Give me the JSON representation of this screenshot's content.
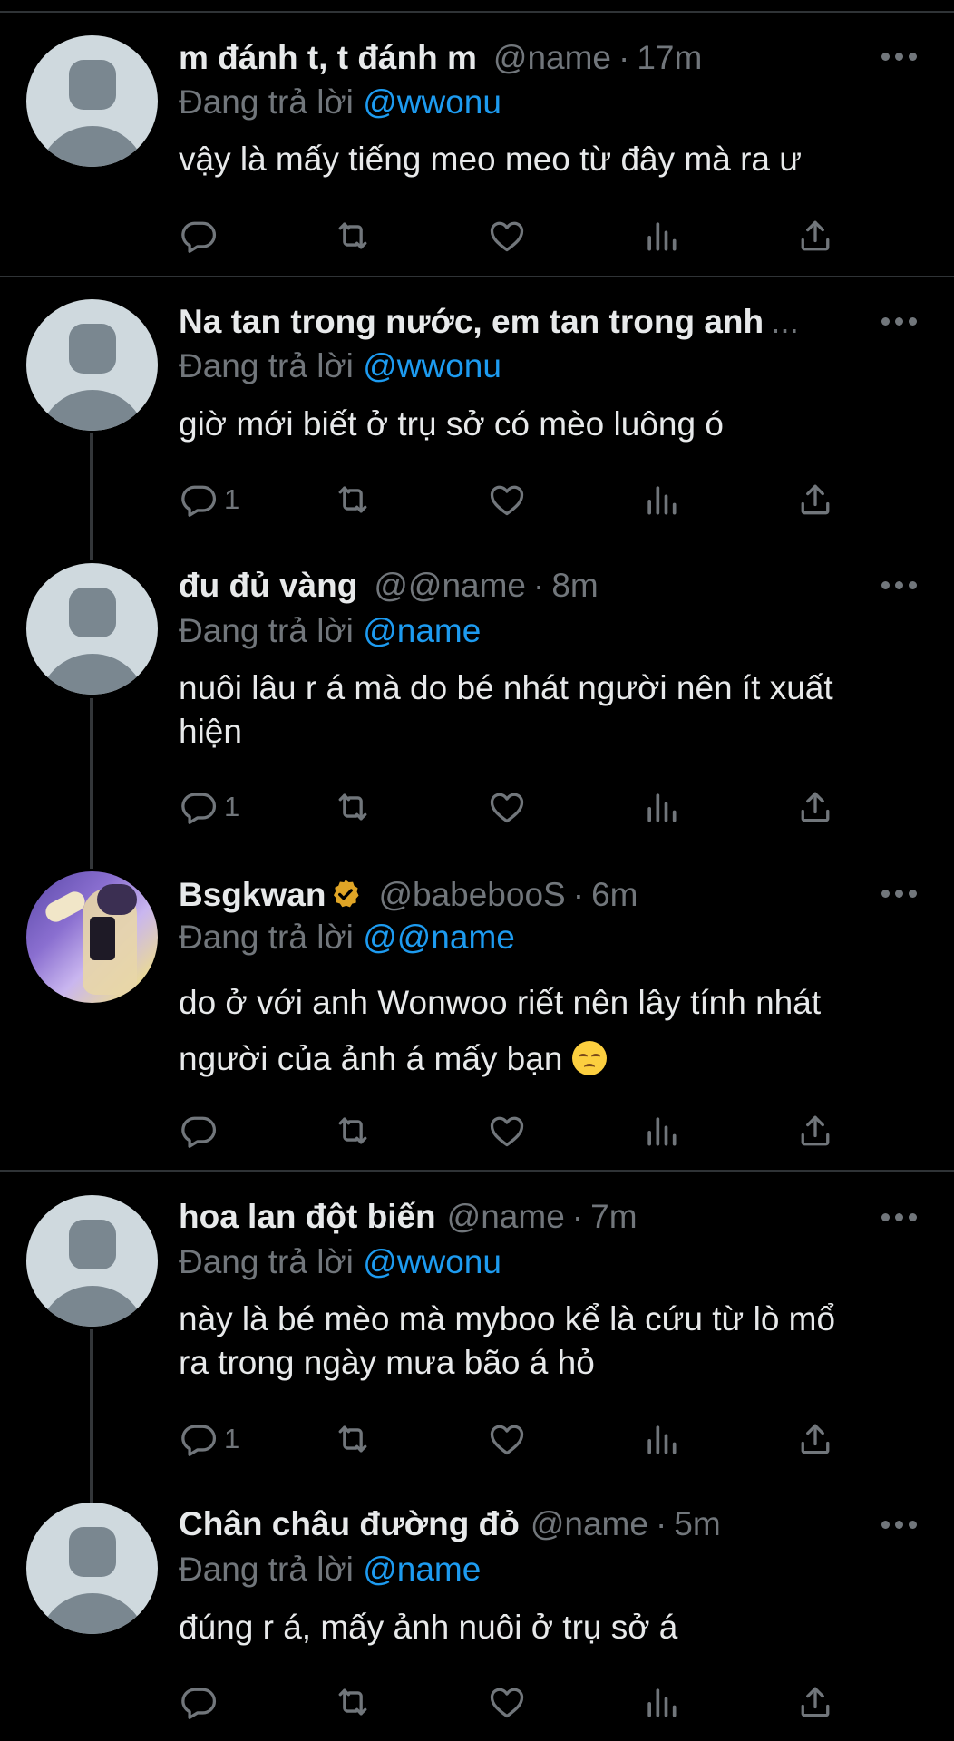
{
  "replying_prefix": "Đang trả lời",
  "tweets": [
    {
      "name": "m đánh t, t đánh m",
      "handle": "@name",
      "time": "17m",
      "replying_to": "@wwonu",
      "text": "vậy là mấy tiếng meo meo từ đây mà ra ư",
      "reply_count": ""
    },
    {
      "name": "Na tan trong nước, em tan trong anh",
      "ellipsis": "...",
      "replying_to": "@wwonu",
      "text": "giờ mới biết ở trụ sở có mèo luông ó",
      "reply_count": "1"
    },
    {
      "name": "đu đủ vàng",
      "handle": "@@name",
      "time": "8m",
      "replying_to": "@name",
      "text": "nuôi lâu r á mà do bé nhát người nên ít xuất\nhiện",
      "reply_count": "1"
    },
    {
      "name": "Bsgkwan",
      "handle": "@babebooS",
      "time": "6m",
      "replying_to": "@@name",
      "text": "do ở với anh Wonwoo riết nên lây tính nhát\nngười của ảnh á mấy bạn",
      "emoji": "pensive-face",
      "reply_count": ""
    },
    {
      "name": "hoa lan đột biến",
      "handle": "@name",
      "time": "7m",
      "replying_to": "@wwonu",
      "text": "này là bé mèo mà myboo kể là cứu từ lò mổ\nra trong ngày mưa bão á hỏ",
      "reply_count": "1"
    },
    {
      "name": "Chân châu đường đỏ",
      "handle": "@name",
      "time": "5m",
      "replying_to": "@name",
      "text": "đúng r á, mấy ảnh nuôi ở trụ sở á",
      "reply_count": ""
    }
  ],
  "dot": "·",
  "colors": {
    "background": "#000000",
    "text": "#e7e9ea",
    "muted": "#71767b",
    "mention": "#1d9bf0",
    "divider": "#2f3336",
    "verified": "#e0a526"
  }
}
